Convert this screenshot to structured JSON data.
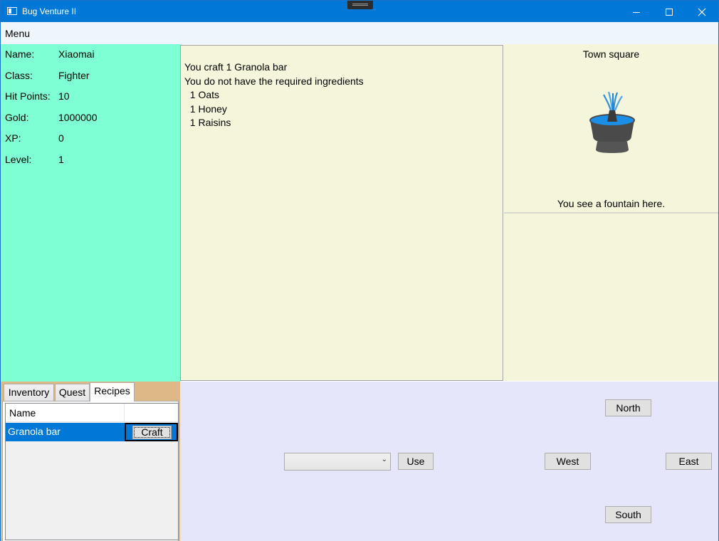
{
  "window": {
    "title": "Bug Venture II"
  },
  "menu": {
    "label": "Menu"
  },
  "player": {
    "stats": [
      {
        "label": "Name:",
        "value": "Xiaomai"
      },
      {
        "label": "Class:",
        "value": "Fighter"
      },
      {
        "label": "Hit Points:",
        "value": "10"
      },
      {
        "label": "Gold:",
        "value": "1000000"
      },
      {
        "label": "XP:",
        "value": "0"
      },
      {
        "label": "Level:",
        "value": "1"
      }
    ]
  },
  "messages": [
    "You craft 1 Granola bar",
    "You do not have the required ingredients",
    "  1 Oats",
    "  1 Honey",
    "  1 Raisins"
  ],
  "location": {
    "name": "Town square",
    "description": "You see a fountain here.",
    "image_icon": "fountain-icon"
  },
  "tabs": {
    "items": [
      "Inventory",
      "Quest",
      "Recipes"
    ],
    "selected": "Recipes"
  },
  "recipes": {
    "header": {
      "name": "Name",
      "action": ""
    },
    "rows": [
      {
        "name": "Granola bar",
        "action": "Craft"
      }
    ]
  },
  "controls": {
    "consumable_value": "",
    "use_label": "Use",
    "north_label": "North",
    "west_label": "West",
    "east_label": "East",
    "south_label": "South"
  },
  "colors": {
    "player_panel": "#7fffd4",
    "messages_bg": "#f5f5dc",
    "controls_bg": "#e6e6fa",
    "tab_area_bg": "#deb887",
    "selected_row": "#0078d7",
    "title_bar": "#0078d7"
  }
}
